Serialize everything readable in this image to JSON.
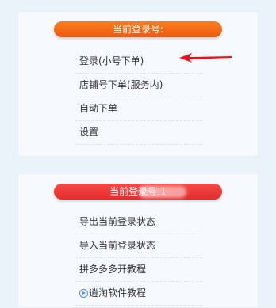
{
  "top_panel": {
    "header": "当前登录号:",
    "header_color": "#f26a14",
    "items": [
      {
        "label": "登录(小号下单)"
      },
      {
        "label": "店铺号下单(服务内)"
      },
      {
        "label": "自动下单"
      },
      {
        "label": "设置"
      }
    ]
  },
  "bottom_panel": {
    "header": "当前登录号:1",
    "header_color": "#e8383a",
    "items": [
      {
        "label": "导出当前登录状态"
      },
      {
        "label": "导入当前登录状态"
      },
      {
        "label": "拼多多多开教程"
      },
      {
        "label": "逍淘软件教程",
        "icon": "play-circle-icon"
      }
    ]
  },
  "annotation": {
    "arrow_color": "#e8141d",
    "icon": "red-arrow-icon"
  }
}
